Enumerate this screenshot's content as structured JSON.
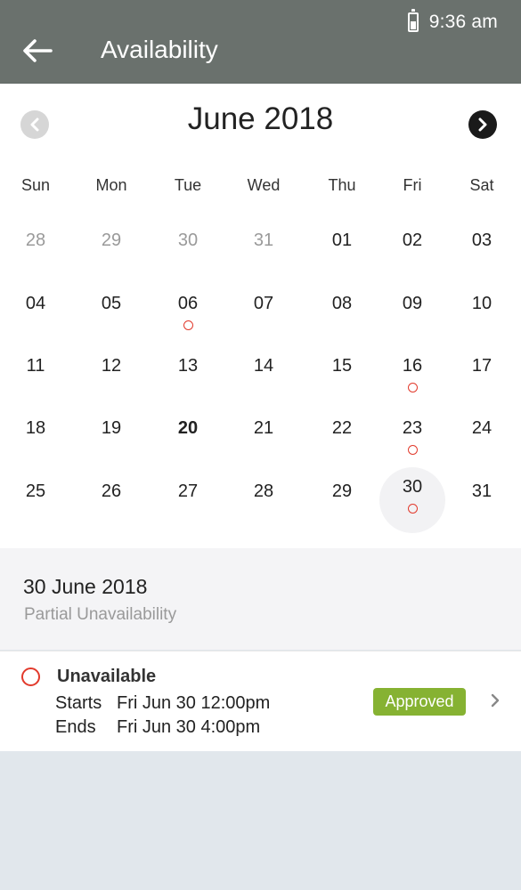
{
  "status_bar": {
    "time": "9:36 am",
    "battery_icon": "battery-icon"
  },
  "app_bar": {
    "title": "Availability",
    "back_icon": "arrow-left-icon"
  },
  "calendar": {
    "month_label": "June 2018",
    "prev_icon": "chevron-left-icon",
    "next_icon": "chevron-right-icon",
    "weekdays": [
      "Sun",
      "Mon",
      "Tue",
      "Wed",
      "Thu",
      "Fri",
      "Sat"
    ],
    "weeks": [
      [
        "28",
        "29",
        "30",
        "31",
        "01",
        "02",
        "03"
      ],
      [
        "04",
        "05",
        "06",
        "07",
        "08",
        "09",
        "10"
      ],
      [
        "11",
        "12",
        "13",
        "14",
        "15",
        "16",
        "17"
      ],
      [
        "18",
        "19",
        "20",
        "21",
        "22",
        "23",
        "24"
      ],
      [
        "25",
        "26",
        "27",
        "28",
        "29",
        "30",
        "31"
      ]
    ],
    "other_month_days": [
      "28",
      "29",
      "30",
      "31"
    ],
    "today": "20",
    "selected": "30",
    "marked_days": [
      "06",
      "16",
      "23",
      "30"
    ],
    "marker_color": "#e23a2c"
  },
  "selected_day": {
    "date": "30 June 2018",
    "status": "Partial Unavailability"
  },
  "event": {
    "title": "Unavailable",
    "starts_label": "Starts",
    "starts_value": "Fri Jun 30 12:00pm",
    "ends_label": "Ends",
    "ends_value": "Fri Jun 30 4:00pm",
    "badge": "Approved",
    "badge_color": "#86b232",
    "chevron_icon": "chevron-right-icon"
  },
  "colors": {
    "app_bar": "#6a716d",
    "background": "#e1e7ec"
  }
}
